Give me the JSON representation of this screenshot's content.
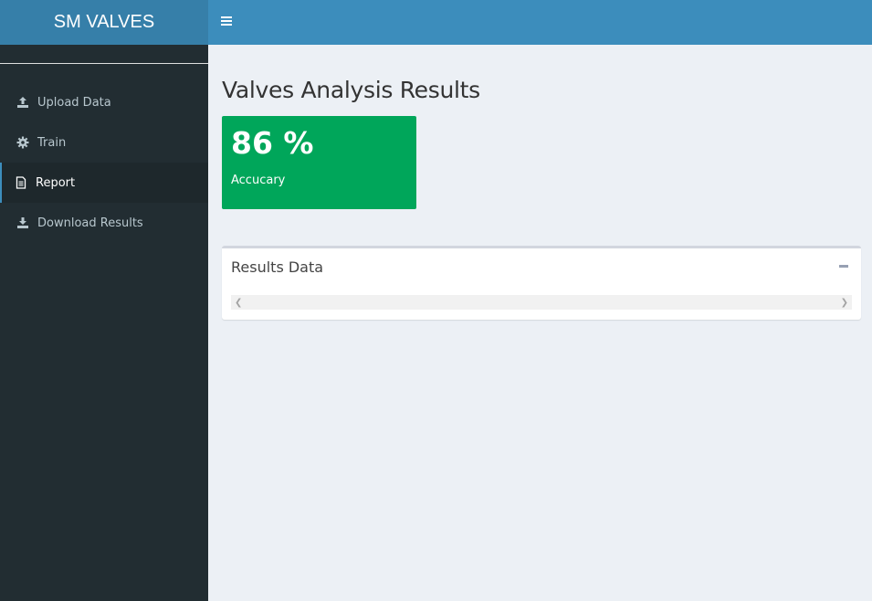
{
  "app": {
    "title": "SM VALVES"
  },
  "header": {
    "toggle_icon": "hamburger-icon"
  },
  "sidebar": {
    "items": [
      {
        "label": "Upload Data",
        "icon": "upload-icon",
        "active": false
      },
      {
        "label": "Train",
        "icon": "gear-icon",
        "active": false
      },
      {
        "label": "Report",
        "icon": "document-icon",
        "active": true
      },
      {
        "label": "Download Results",
        "icon": "download-icon",
        "active": false
      }
    ]
  },
  "main": {
    "title": "Valves Analysis Results",
    "value_box": {
      "value": "86 %",
      "label": "Accucary",
      "color": "#00a65a"
    },
    "results_box": {
      "title": "Results Data",
      "collapse_icon": "minus-icon",
      "scroll_left_icon": "chevron-left-icon",
      "scroll_right_icon": "chevron-right-icon"
    }
  },
  "colors": {
    "header": "#3c8dbc",
    "logo": "#367fa9",
    "sidebar": "#222d32",
    "content_bg": "#ecf0f5"
  }
}
